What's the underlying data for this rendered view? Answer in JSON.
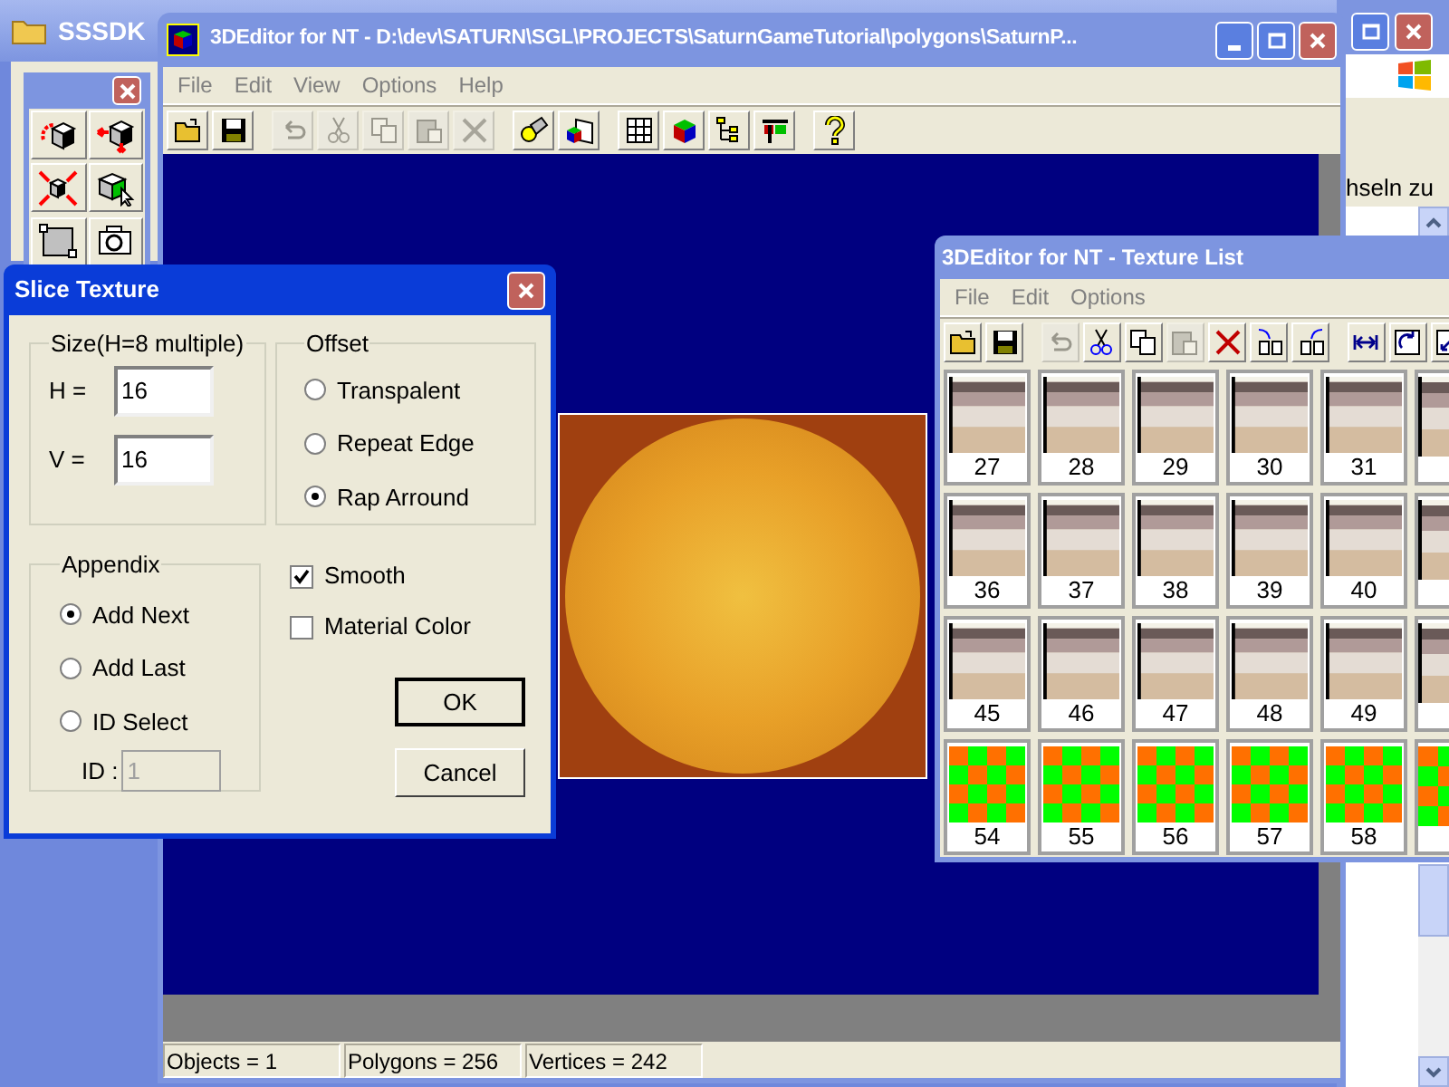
{
  "background_window": {
    "title": "SSSDK",
    "side_text": "hseln zu"
  },
  "toolbox": {
    "tools": [
      {
        "kind": "spin"
      },
      {
        "kind": "move"
      },
      {
        "kind": "scale"
      },
      {
        "kind": "paint"
      },
      {
        "kind": "texture"
      },
      {
        "kind": "camera"
      }
    ]
  },
  "main_window": {
    "title": "3DEditor for NT - D:\\dev\\SATURN\\SGL\\PROJECTS\\SaturnGameTutorial\\polygons\\SaturnP...",
    "menu": [
      "File",
      "Edit",
      "View",
      "Options",
      "Help"
    ],
    "toolbar": [
      {
        "kind": "open",
        "disabled": false
      },
      {
        "kind": "save",
        "disabled": false
      },
      {
        "kind": "separator"
      },
      {
        "kind": "undo",
        "disabled": true
      },
      {
        "kind": "cut",
        "disabled": true
      },
      {
        "kind": "copy",
        "disabled": true
      },
      {
        "kind": "paste",
        "disabled": true
      },
      {
        "kind": "delete",
        "disabled": true
      },
      {
        "kind": "separator"
      },
      {
        "kind": "light",
        "disabled": false
      },
      {
        "kind": "render",
        "disabled": false
      },
      {
        "kind": "separator"
      },
      {
        "kind": "grid",
        "disabled": false
      },
      {
        "kind": "cube",
        "disabled": false
      },
      {
        "kind": "tree",
        "disabled": false
      },
      {
        "kind": "chart",
        "disabled": false
      },
      {
        "kind": "separator"
      },
      {
        "kind": "help",
        "disabled": false
      }
    ],
    "status_bar": [
      "Objects = 1",
      "Polygons = 256",
      "Vertices = 242"
    ]
  },
  "dialog": {
    "title": "Slice Texture",
    "size_group": {
      "label": "Size(H=8 multiple)",
      "fields": [
        {
          "label": "H =",
          "value": "16"
        },
        {
          "label": "V =",
          "value": "16"
        }
      ]
    },
    "offset_group": {
      "label": "Offset",
      "options": [
        {
          "label": "Transpalent",
          "selected": false
        },
        {
          "label": "Repeat Edge",
          "selected": false
        },
        {
          "label": "Rap Arround",
          "selected": true
        }
      ]
    },
    "appendix_group": {
      "label": "Appendix",
      "options": [
        {
          "label": "Add Next",
          "selected": true
        },
        {
          "label": "Add Last",
          "selected": false
        },
        {
          "label": "ID Select",
          "selected": false
        }
      ],
      "id_field": {
        "label": "ID :",
        "value": "1",
        "disabled": true
      }
    },
    "checkboxes": [
      {
        "label": "Smooth",
        "checked": true
      },
      {
        "label": "Material Color",
        "checked": false
      }
    ],
    "buttons": [
      {
        "label": "OK",
        "default": true
      },
      {
        "label": "Cancel",
        "default": false
      }
    ]
  },
  "texture_list": {
    "title": "3DEditor for NT - Texture List",
    "menu": [
      "File",
      "Edit",
      "Options"
    ],
    "toolbar": [
      {
        "kind": "open",
        "disabled": false
      },
      {
        "kind": "save",
        "disabled": false
      },
      {
        "kind": "separator"
      },
      {
        "kind": "undo",
        "disabled": true
      },
      {
        "kind": "cut",
        "disabled": false
      },
      {
        "kind": "copy",
        "disabled": false
      },
      {
        "kind": "paste",
        "disabled": true
      },
      {
        "kind": "delete",
        "disabled": false
      },
      {
        "kind": "insert_before",
        "disabled": false
      },
      {
        "kind": "insert_after",
        "disabled": false
      },
      {
        "kind": "separator"
      },
      {
        "kind": "fit_width",
        "disabled": false
      },
      {
        "kind": "rotate",
        "disabled": false
      },
      {
        "kind": "expand",
        "disabled": false
      }
    ],
    "textures": [
      {
        "label": "27",
        "kind": "stripes"
      },
      {
        "label": "28",
        "kind": "stripes"
      },
      {
        "label": "29",
        "kind": "stripes"
      },
      {
        "label": "30",
        "kind": "stripes"
      },
      {
        "label": "31",
        "kind": "stripes"
      },
      {
        "kind": "stripes"
      },
      {
        "label": "36",
        "kind": "stripes"
      },
      {
        "label": "37",
        "kind": "stripes"
      },
      {
        "label": "38",
        "kind": "stripes"
      },
      {
        "label": "39",
        "kind": "stripes"
      },
      {
        "label": "40",
        "kind": "stripes"
      },
      {
        "kind": "stripes"
      },
      {
        "label": "45",
        "kind": "stripes"
      },
      {
        "label": "46",
        "kind": "stripes"
      },
      {
        "label": "47",
        "kind": "stripes"
      },
      {
        "label": "48",
        "kind": "stripes"
      },
      {
        "label": "49",
        "kind": "stripes"
      },
      {
        "kind": "stripes"
      },
      {
        "label": "54",
        "kind": "checker"
      },
      {
        "label": "55",
        "kind": "checker"
      },
      {
        "label": "56",
        "kind": "checker"
      },
      {
        "label": "57",
        "kind": "checker"
      },
      {
        "label": "58",
        "kind": "checker"
      },
      {
        "kind": "checker"
      }
    ]
  }
}
